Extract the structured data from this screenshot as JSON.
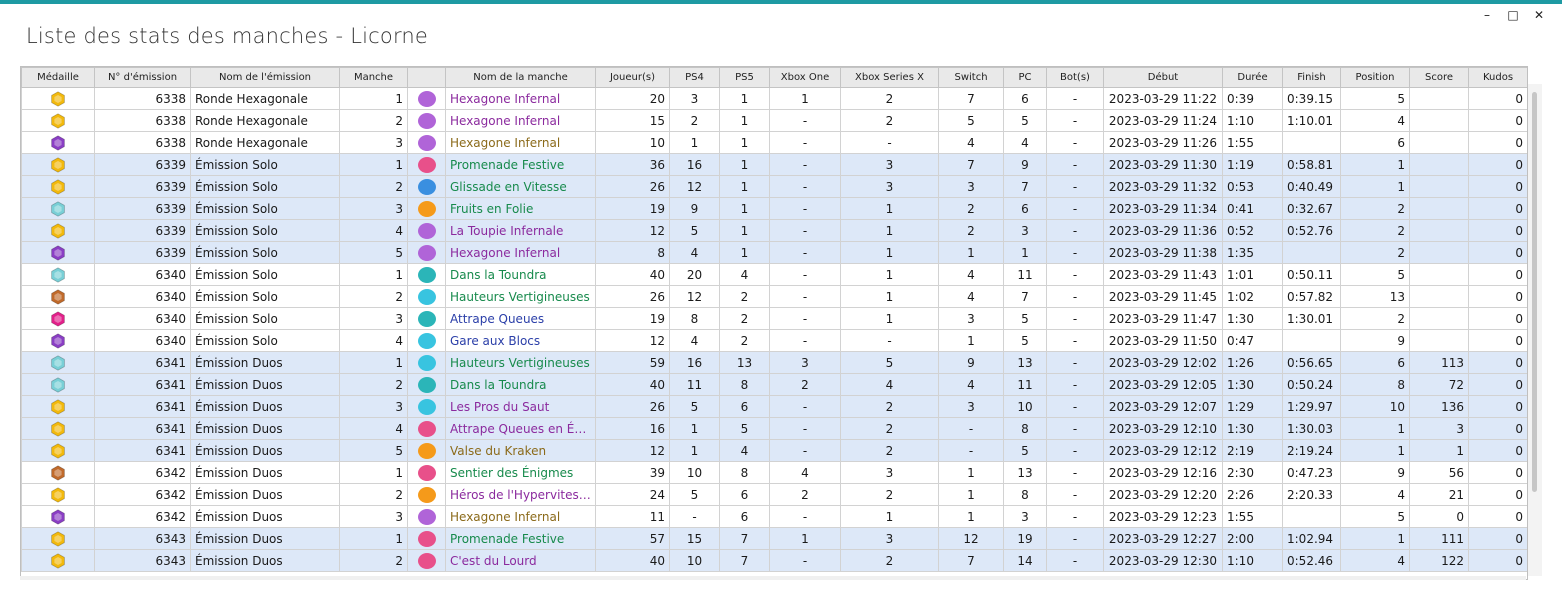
{
  "window": {
    "title": "Liste des stats des manches - Licorne",
    "controls": [
      "–",
      "□",
      "✕"
    ]
  },
  "columns": [
    "Médaille",
    "N° d'émission",
    "Nom de l'émission",
    "Manche",
    "",
    "Nom de la manche",
    "Joueur(s)",
    "PS4",
    "PS5",
    "Xbox One",
    "Xbox Series X",
    "Switch",
    "PC",
    "Bot(s)",
    "Début",
    "Durée",
    "Finish",
    "Position",
    "Score",
    "Kudos"
  ],
  "colors": {
    "gold": "#f2b90d",
    "bronze": "#c06a2b",
    "pink": "#e2208a",
    "purple": "#8a3ec4",
    "teal": "#79cfd6",
    "purple_text": "#8b2a9e",
    "green_text": "#178a4c",
    "brown_text": "#8b6a1a",
    "blue_text": "#2a3ea8"
  },
  "rows": [
    {
      "medal": "gold",
      "emission": "6338",
      "show": "Ronde Hexagonale",
      "round": "1",
      "icon": "purple",
      "name": "Hexagone Infernal",
      "name_color": "purple_text",
      "players": "20",
      "ps4": "3",
      "ps5": "1",
      "xone": "1",
      "xsx": "2",
      "switch": "7",
      "pc": "6",
      "bots": "-",
      "start": "2023-03-29 11:22",
      "duration": "0:39",
      "finish": "0:39.15",
      "position": "5",
      "score": "",
      "kudos": "0",
      "alt": false
    },
    {
      "medal": "gold",
      "emission": "6338",
      "show": "Ronde Hexagonale",
      "round": "2",
      "icon": "purple",
      "name": "Hexagone Infernal",
      "name_color": "purple_text",
      "players": "15",
      "ps4": "2",
      "ps5": "1",
      "xone": "-",
      "xsx": "2",
      "switch": "5",
      "pc": "5",
      "bots": "-",
      "start": "2023-03-29 11:24",
      "duration": "1:10",
      "finish": "1:10.01",
      "position": "4",
      "score": "",
      "kudos": "0",
      "alt": false
    },
    {
      "medal": "purple",
      "emission": "6338",
      "show": "Ronde Hexagonale",
      "round": "3",
      "icon": "purple",
      "name": "Hexagone Infernal",
      "name_color": "brown_text",
      "players": "10",
      "ps4": "1",
      "ps5": "1",
      "xone": "-",
      "xsx": "-",
      "switch": "4",
      "pc": "4",
      "bots": "-",
      "start": "2023-03-29 11:26",
      "duration": "1:55",
      "finish": "",
      "position": "6",
      "score": "",
      "kudos": "0",
      "alt": false
    },
    {
      "medal": "gold",
      "emission": "6339",
      "show": "Émission Solo",
      "round": "1",
      "icon": "pink",
      "name": "Promenade Festive",
      "name_color": "green_text",
      "players": "36",
      "ps4": "16",
      "ps5": "1",
      "xone": "-",
      "xsx": "3",
      "switch": "7",
      "pc": "9",
      "bots": "-",
      "start": "2023-03-29 11:30",
      "duration": "1:19",
      "finish": "0:58.81",
      "position": "1",
      "score": "",
      "kudos": "0",
      "alt": true
    },
    {
      "medal": "gold",
      "emission": "6339",
      "show": "Émission Solo",
      "round": "2",
      "icon": "blue",
      "name": "Glissade en Vitesse",
      "name_color": "green_text",
      "players": "26",
      "ps4": "12",
      "ps5": "1",
      "xone": "-",
      "xsx": "3",
      "switch": "3",
      "pc": "7",
      "bots": "-",
      "start": "2023-03-29 11:32",
      "duration": "0:53",
      "finish": "0:40.49",
      "position": "1",
      "score": "",
      "kudos": "0",
      "alt": true
    },
    {
      "medal": "teal",
      "emission": "6339",
      "show": "Émission Solo",
      "round": "3",
      "icon": "orange",
      "name": "Fruits en Folie",
      "name_color": "green_text",
      "players": "19",
      "ps4": "9",
      "ps5": "1",
      "xone": "-",
      "xsx": "1",
      "switch": "2",
      "pc": "6",
      "bots": "-",
      "start": "2023-03-29 11:34",
      "duration": "0:41",
      "finish": "0:32.67",
      "position": "2",
      "score": "",
      "kudos": "0",
      "alt": true
    },
    {
      "medal": "gold",
      "emission": "6339",
      "show": "Émission Solo",
      "round": "4",
      "icon": "purple",
      "name": "La Toupie Infernale",
      "name_color": "purple_text",
      "players": "12",
      "ps4": "5",
      "ps5": "1",
      "xone": "-",
      "xsx": "1",
      "switch": "2",
      "pc": "3",
      "bots": "-",
      "start": "2023-03-29 11:36",
      "duration": "0:52",
      "finish": "0:52.76",
      "position": "2",
      "score": "",
      "kudos": "0",
      "alt": true
    },
    {
      "medal": "purple",
      "emission": "6339",
      "show": "Émission Solo",
      "round": "5",
      "icon": "purple",
      "name": "Hexagone Infernal",
      "name_color": "purple_text",
      "players": "8",
      "ps4": "4",
      "ps5": "1",
      "xone": "-",
      "xsx": "1",
      "switch": "1",
      "pc": "1",
      "bots": "-",
      "start": "2023-03-29 11:38",
      "duration": "1:35",
      "finish": "",
      "position": "2",
      "score": "",
      "kudos": "0",
      "alt": true
    },
    {
      "medal": "teal",
      "emission": "6340",
      "show": "Émission Solo",
      "round": "1",
      "icon": "teal",
      "name": "Dans la Toundra",
      "name_color": "green_text",
      "players": "40",
      "ps4": "20",
      "ps5": "4",
      "xone": "-",
      "xsx": "1",
      "switch": "4",
      "pc": "11",
      "bots": "-",
      "start": "2023-03-29 11:43",
      "duration": "1:01",
      "finish": "0:50.11",
      "position": "5",
      "score": "",
      "kudos": "0",
      "alt": false
    },
    {
      "medal": "bronze",
      "emission": "6340",
      "show": "Émission Solo",
      "round": "2",
      "icon": "cyan",
      "name": "Hauteurs Vertigineuses",
      "name_color": "green_text",
      "players": "26",
      "ps4": "12",
      "ps5": "2",
      "xone": "-",
      "xsx": "1",
      "switch": "4",
      "pc": "7",
      "bots": "-",
      "start": "2023-03-29 11:45",
      "duration": "1:02",
      "finish": "0:57.82",
      "position": "13",
      "score": "",
      "kudos": "0",
      "alt": false
    },
    {
      "medal": "pink",
      "emission": "6340",
      "show": "Émission Solo",
      "round": "3",
      "icon": "teal",
      "name": "Attrape Queues",
      "name_color": "blue_text",
      "players": "19",
      "ps4": "8",
      "ps5": "2",
      "xone": "-",
      "xsx": "1",
      "switch": "3",
      "pc": "5",
      "bots": "-",
      "start": "2023-03-29 11:47",
      "duration": "1:30",
      "finish": "1:30.01",
      "position": "2",
      "score": "",
      "kudos": "0",
      "alt": false
    },
    {
      "medal": "purple",
      "emission": "6340",
      "show": "Émission Solo",
      "round": "4",
      "icon": "cyan",
      "name": "Gare aux Blocs",
      "name_color": "blue_text",
      "players": "12",
      "ps4": "4",
      "ps5": "2",
      "xone": "-",
      "xsx": "-",
      "switch": "1",
      "pc": "5",
      "bots": "-",
      "start": "2023-03-29 11:50",
      "duration": "0:47",
      "finish": "",
      "position": "9",
      "score": "",
      "kudos": "0",
      "alt": false
    },
    {
      "medal": "teal",
      "emission": "6341",
      "show": "Émission Duos",
      "round": "1",
      "icon": "cyan",
      "name": "Hauteurs Vertigineuses",
      "name_color": "green_text",
      "players": "59",
      "ps4": "16",
      "ps5": "13",
      "xone": "3",
      "xsx": "5",
      "switch": "9",
      "pc": "13",
      "bots": "-",
      "start": "2023-03-29 12:02",
      "duration": "1:26",
      "finish": "0:56.65",
      "position": "6",
      "score": "113",
      "kudos": "0",
      "alt": true
    },
    {
      "medal": "teal",
      "emission": "6341",
      "show": "Émission Duos",
      "round": "2",
      "icon": "teal",
      "name": "Dans la Toundra",
      "name_color": "green_text",
      "players": "40",
      "ps4": "11",
      "ps5": "8",
      "xone": "2",
      "xsx": "4",
      "switch": "4",
      "pc": "11",
      "bots": "-",
      "start": "2023-03-29 12:05",
      "duration": "1:30",
      "finish": "0:50.24",
      "position": "8",
      "score": "72",
      "kudos": "0",
      "alt": true
    },
    {
      "medal": "gold",
      "emission": "6341",
      "show": "Émission Duos",
      "round": "3",
      "icon": "cyan",
      "name": "Les Pros du Saut",
      "name_color": "purple_text",
      "players": "26",
      "ps4": "5",
      "ps5": "6",
      "xone": "-",
      "xsx": "2",
      "switch": "3",
      "pc": "10",
      "bots": "-",
      "start": "2023-03-29 12:07",
      "duration": "1:29",
      "finish": "1:29.97",
      "position": "10",
      "score": "136",
      "kudos": "0",
      "alt": true
    },
    {
      "medal": "gold",
      "emission": "6341",
      "show": "Émission Duos",
      "round": "4",
      "icon": "pink",
      "name": "Attrape Queues en Équi…",
      "name_color": "purple_text",
      "players": "16",
      "ps4": "1",
      "ps5": "5",
      "xone": "-",
      "xsx": "2",
      "switch": "-",
      "pc": "8",
      "bots": "-",
      "start": "2023-03-29 12:10",
      "duration": "1:30",
      "finish": "1:30.03",
      "position": "1",
      "score": "3",
      "kudos": "0",
      "alt": true
    },
    {
      "medal": "gold",
      "emission": "6341",
      "show": "Émission Duos",
      "round": "5",
      "icon": "orange",
      "name": "Valse du Kraken",
      "name_color": "brown_text",
      "players": "12",
      "ps4": "1",
      "ps5": "4",
      "xone": "-",
      "xsx": "2",
      "switch": "-",
      "pc": "5",
      "bots": "-",
      "start": "2023-03-29 12:12",
      "duration": "2:19",
      "finish": "2:19.24",
      "position": "1",
      "score": "1",
      "kudos": "0",
      "alt": true
    },
    {
      "medal": "bronze",
      "emission": "6342",
      "show": "Émission Duos",
      "round": "1",
      "icon": "pink",
      "name": "Sentier des Énigmes",
      "name_color": "green_text",
      "players": "39",
      "ps4": "10",
      "ps5": "8",
      "xone": "4",
      "xsx": "3",
      "switch": "1",
      "pc": "13",
      "bots": "-",
      "start": "2023-03-29 12:16",
      "duration": "2:30",
      "finish": "0:47.23",
      "position": "9",
      "score": "56",
      "kudos": "0",
      "alt": false
    },
    {
      "medal": "gold",
      "emission": "6342",
      "show": "Émission Duos",
      "round": "2",
      "icon": "orange",
      "name": "Héros de l'Hypervitesse",
      "name_color": "purple_text",
      "players": "24",
      "ps4": "5",
      "ps5": "6",
      "xone": "2",
      "xsx": "2",
      "switch": "1",
      "pc": "8",
      "bots": "-",
      "start": "2023-03-29 12:20",
      "duration": "2:26",
      "finish": "2:20.33",
      "position": "4",
      "score": "21",
      "kudos": "0",
      "alt": false
    },
    {
      "medal": "purple",
      "emission": "6342",
      "show": "Émission Duos",
      "round": "3",
      "icon": "purple",
      "name": "Hexagone Infernal",
      "name_color": "brown_text",
      "players": "11",
      "ps4": "-",
      "ps5": "6",
      "xone": "-",
      "xsx": "1",
      "switch": "1",
      "pc": "3",
      "bots": "-",
      "start": "2023-03-29 12:23",
      "duration": "1:55",
      "finish": "",
      "position": "5",
      "score": "0",
      "kudos": "0",
      "alt": false
    },
    {
      "medal": "gold",
      "emission": "6343",
      "show": "Émission Duos",
      "round": "1",
      "icon": "pink",
      "name": "Promenade Festive",
      "name_color": "green_text",
      "players": "57",
      "ps4": "15",
      "ps5": "7",
      "xone": "1",
      "xsx": "3",
      "switch": "12",
      "pc": "19",
      "bots": "-",
      "start": "2023-03-29 12:27",
      "duration": "2:00",
      "finish": "1:02.94",
      "position": "1",
      "score": "111",
      "kudos": "0",
      "alt": true
    },
    {
      "medal": "gold",
      "emission": "6343",
      "show": "Émission Duos",
      "round": "2",
      "icon": "pink",
      "name": "C'est du Lourd",
      "name_color": "purple_text",
      "players": "40",
      "ps4": "10",
      "ps5": "7",
      "xone": "-",
      "xsx": "2",
      "switch": "7",
      "pc": "14",
      "bots": "-",
      "start": "2023-03-29 12:30",
      "duration": "1:10",
      "finish": "0:52.46",
      "position": "4",
      "score": "122",
      "kudos": "0",
      "alt": true
    }
  ]
}
